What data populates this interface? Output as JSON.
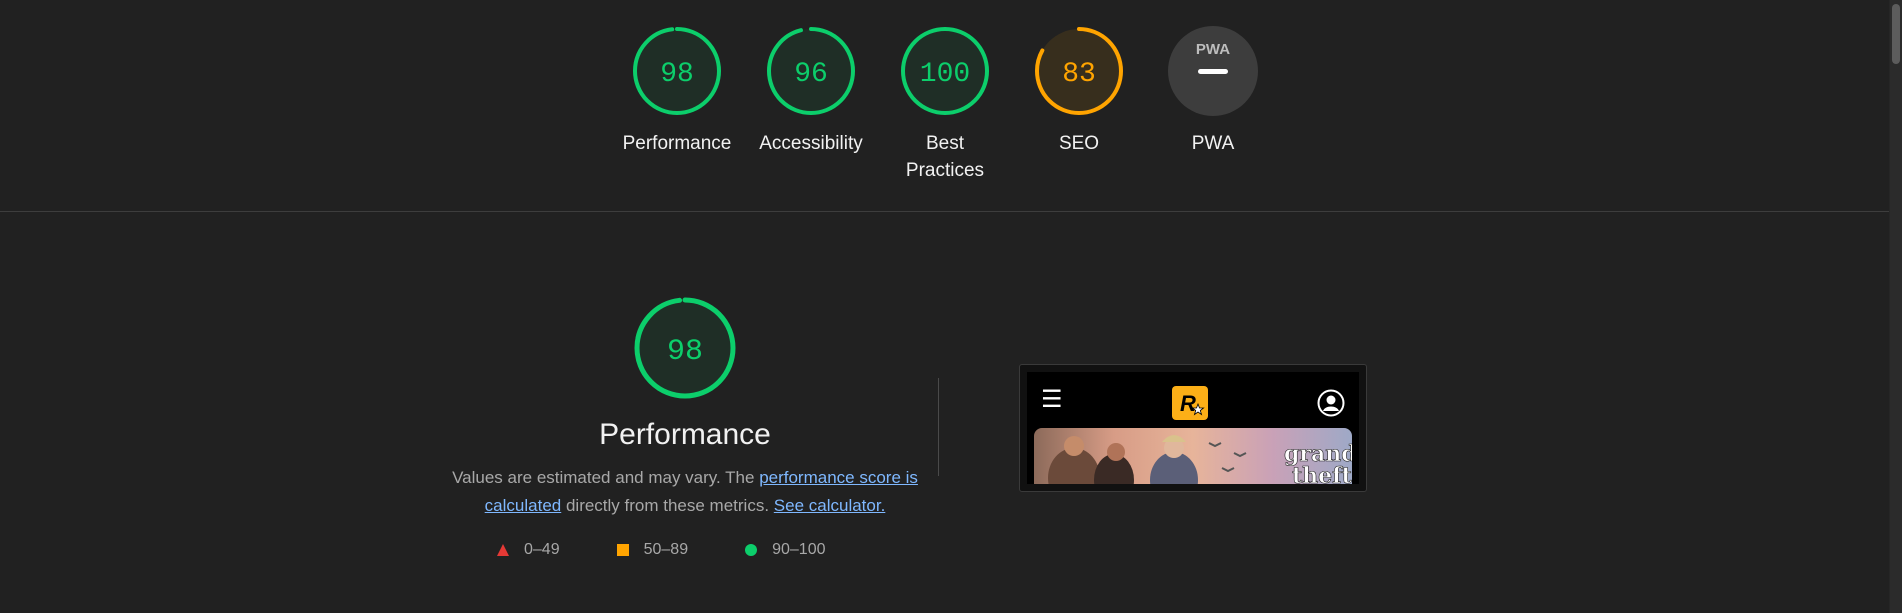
{
  "gauges": [
    {
      "id": "performance",
      "score": "98",
      "label_line1": "Performance",
      "label_line2": "",
      "status": "pass"
    },
    {
      "id": "accessibility",
      "score": "96",
      "label_line1": "Accessibility",
      "label_line2": "",
      "status": "pass"
    },
    {
      "id": "best-practices",
      "score": "100",
      "label_line1": "Best",
      "label_line2": "Practices",
      "status": "pass"
    },
    {
      "id": "seo",
      "score": "83",
      "label_line1": "SEO",
      "label_line2": "",
      "status": "average"
    },
    {
      "id": "pwa",
      "score": "",
      "label_line1": "PWA",
      "label_line2": "",
      "status": "pwa"
    }
  ],
  "pwa_badge_text": "PWA",
  "performance": {
    "score": "98",
    "title": "Performance",
    "desc_prefix": "Values are estimated and may vary. The ",
    "desc_link1": "performance score is calculated",
    "desc_middle": " directly from these metrics. ",
    "desc_link2": "See calculator."
  },
  "legend": [
    {
      "range": "0–49",
      "shape": "triangle",
      "color": "#e53935"
    },
    {
      "range": "50–89",
      "shape": "square",
      "color": "#ffa400"
    },
    {
      "range": "90–100",
      "shape": "circle",
      "color": "#0cce6b"
    }
  ],
  "colors": {
    "pass": "#0cce6b",
    "average": "#ffa400",
    "fail": "#ff4e42",
    "pwa_bg": "#3d3d3d"
  },
  "thumbnail": {
    "menu_icon": "hamburger-icon",
    "logo_text": "R",
    "user_icon": "user-circle-icon",
    "banner_title_line1": "grand",
    "banner_title_line2": "theft"
  }
}
